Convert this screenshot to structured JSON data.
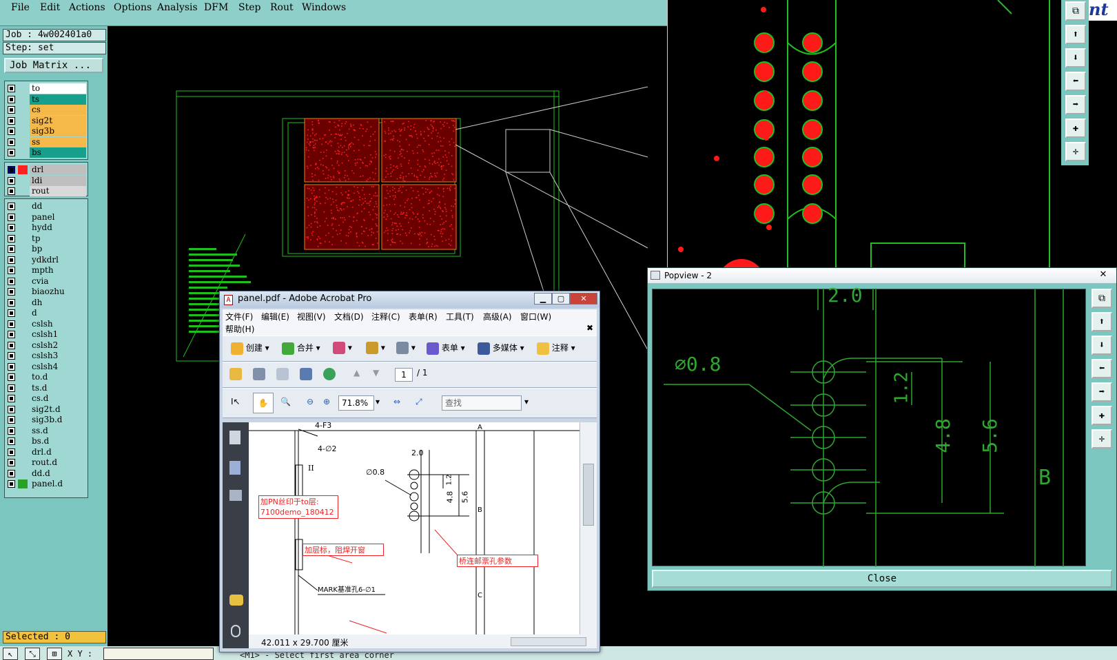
{
  "menu": [
    "File",
    "Edit",
    "Actions",
    "Options",
    "Analysis",
    "DFM",
    "Step",
    "Rout",
    "Windows"
  ],
  "job": {
    "job_label": "Job : 4w002401a0",
    "step_label": "Step: set",
    "matrix_button": "Job Matrix ..."
  },
  "layers_group1": [
    {
      "name": "to",
      "color": "#ffffff"
    },
    {
      "name": "ts",
      "color": "#16a08c"
    },
    {
      "name": "cs",
      "color": "#f5b94a"
    },
    {
      "name": "sig2t",
      "color": "#f5b94a"
    },
    {
      "name": "sig3b",
      "color": "#f5b94a"
    },
    {
      "name": "ss",
      "color": "#f5b94a"
    },
    {
      "name": "bs",
      "color": "#16a08c"
    }
  ],
  "layers_group2": [
    {
      "name": "drl",
      "color": "#bfbfbf",
      "swatch": "#ff2020",
      "selected": true
    },
    {
      "name": "ldi",
      "color": "#bfbfbf"
    },
    {
      "name": "rout",
      "color": "#d9d9d9"
    }
  ],
  "layers_group3": [
    {
      "name": "dd"
    },
    {
      "name": "panel"
    },
    {
      "name": "hydd"
    },
    {
      "name": "tp"
    },
    {
      "name": "bp"
    },
    {
      "name": "ydkdrl"
    },
    {
      "name": "mpth"
    },
    {
      "name": "cvia"
    },
    {
      "name": "biaozhu"
    },
    {
      "name": "dh"
    },
    {
      "name": "d"
    },
    {
      "name": "cslsh"
    },
    {
      "name": "cslsh1"
    },
    {
      "name": "cslsh2"
    },
    {
      "name": "cslsh3"
    },
    {
      "name": "cslsh4"
    },
    {
      "name": "to.d"
    },
    {
      "name": "ts.d"
    },
    {
      "name": "cs.d"
    },
    {
      "name": "sig2t.d"
    },
    {
      "name": "sig3b.d"
    },
    {
      "name": "ss.d"
    },
    {
      "name": "bs.d"
    },
    {
      "name": "drl.d"
    },
    {
      "name": "rout.d"
    },
    {
      "name": "dd.d"
    },
    {
      "name": "panel.d",
      "swatch": "#2aa02a"
    }
  ],
  "selected_label": "Selected : 0",
  "status": {
    "xy_label": "X Y :",
    "prompt": "<M1> - Select first area corner"
  },
  "acrobat": {
    "title": "panel.pdf - Adobe Acrobat Pro",
    "menu": [
      "文件(F)",
      "编辑(E)",
      "视图(V)",
      "文档(D)",
      "注释(C)",
      "表单(R)",
      "工具(T)",
      "高级(A)",
      "窗口(W)",
      "帮助(H)"
    ],
    "toolbar": [
      "创建",
      "合并",
      "表单",
      "多媒体",
      "注释"
    ],
    "page_num": "1",
    "page_total": "/ 1",
    "zoom": "71.8%",
    "search_placeholder": "查找",
    "size_label": "42.011 x 29.700 厘米",
    "annotations": [
      "加PN丝印于to层:\n7100demo_180412",
      "加层标，阻焊开窗",
      "桥连邮票孔参数"
    ],
    "doc_labels": {
      "a": "4-F3",
      "b": "4-∅2",
      "c": "II",
      "d": "2.0",
      "e": "∅0.8",
      "f": "1.2",
      "g": "4.8",
      "h": "5.6",
      "i": "MARK基准孔6-∅1",
      "j": "A",
      "k": "B",
      "l": "C"
    }
  },
  "popview": {
    "title": "Popview - 2",
    "close_label": "Close",
    "labels": {
      "dim1": "2.0",
      "dia": "∅0.8",
      "dim2": "1.2",
      "dim3": "4.8",
      "dim4": "5.6",
      "b": "B"
    }
  },
  "colors": {
    "panel_bg": "#7cc6c0",
    "pad": "#ff1a1a",
    "trace": "#2ea82e",
    "outline": "#1fbf1f"
  }
}
